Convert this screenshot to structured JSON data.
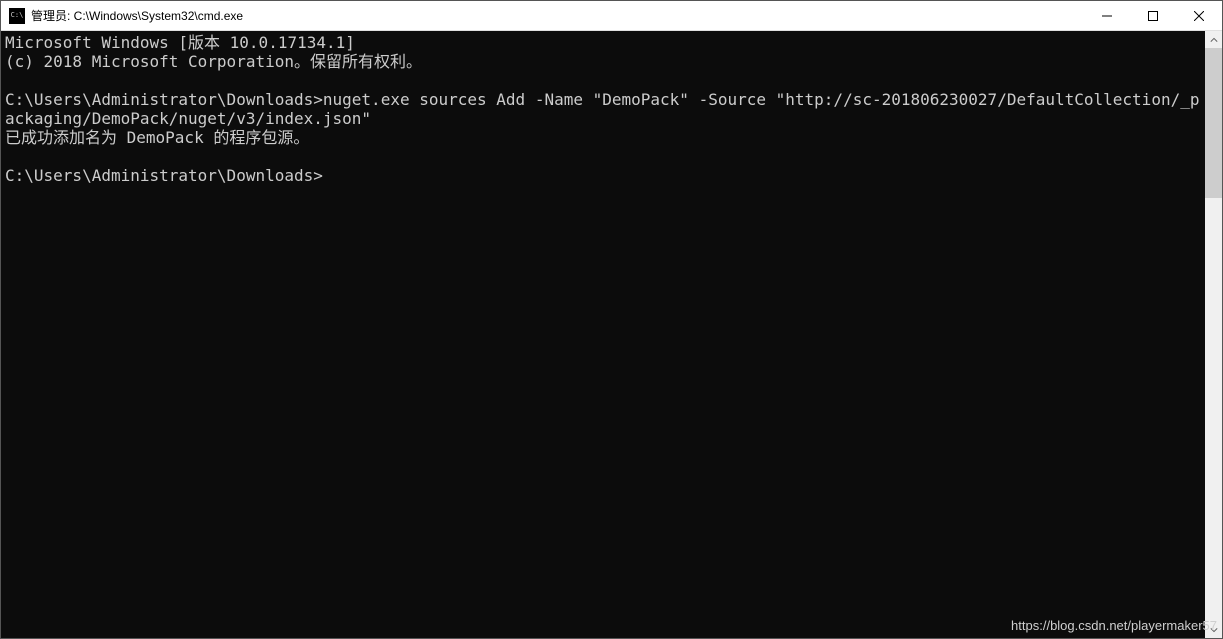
{
  "window": {
    "title": "管理员: C:\\Windows\\System32\\cmd.exe"
  },
  "terminal": {
    "line1": "Microsoft Windows [版本 10.0.17134.1]",
    "line2": "(c) 2018 Microsoft Corporation。保留所有权利。",
    "blank1": "",
    "prompt1": "C:\\Users\\Administrator\\Downloads>",
    "command1": "nuget.exe sources Add -Name \"DemoPack\" -Source \"http://sc-201806230027/DefaultCollection/_packaging/DemoPack/nuget/v3/index.json\"",
    "result1": "已成功添加名为 DemoPack 的程序包源。",
    "blank2": "",
    "prompt2": "C:\\Users\\Administrator\\Downloads>"
  },
  "watermark": "https://blog.csdn.net/playermaker57"
}
